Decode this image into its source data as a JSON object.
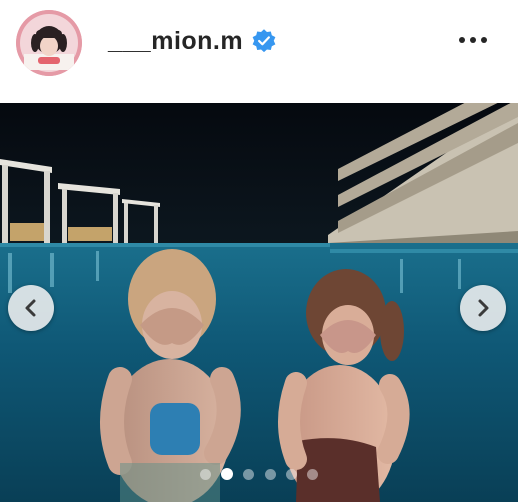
{
  "post": {
    "username": "___mion.m",
    "verified": true,
    "avatar_icon": "profile-avatar",
    "more_icon": "more-horizontal-icon"
  },
  "carousel": {
    "prev_icon": "chevron-left-icon",
    "next_icon": "chevron-right-icon",
    "slide_count": 6,
    "active_index": 1
  },
  "colors": {
    "verified_blue": "#3797f0",
    "text": "#262626",
    "pool": "#0e4f6b"
  }
}
